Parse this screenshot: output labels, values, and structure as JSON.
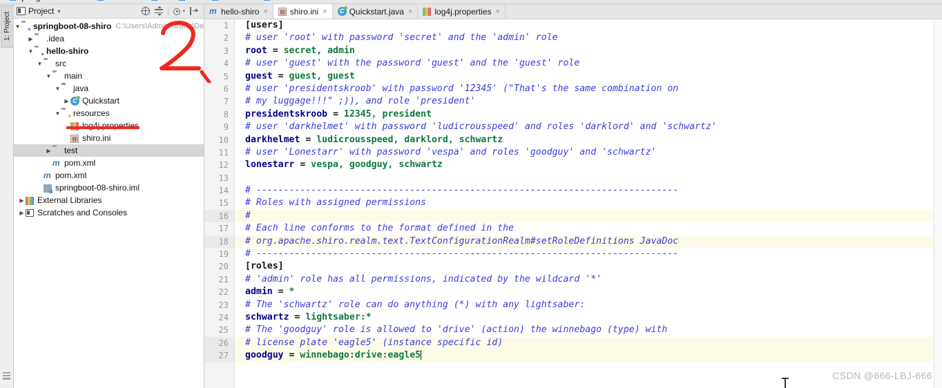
{
  "window": {
    "breadcrumbs": [
      "springboot-08-shiro",
      "hello-shiro",
      "src",
      "main",
      "resources",
      "shiro.ini"
    ]
  },
  "tool_strip": {
    "project_tab_label": "1: Project",
    "structure_icon": "structure-icon"
  },
  "project_panel": {
    "title": "Project",
    "caret": "▾",
    "actions": [
      {
        "name": "locate-icon",
        "label": "Select Opened File"
      },
      {
        "name": "collapse-all-icon",
        "label": "Collapse All"
      },
      {
        "name": "settings-gear-icon",
        "label": "Settings"
      },
      {
        "name": "hide-panel-icon",
        "label": "Hide"
      }
    ],
    "tree": [
      {
        "label": "springboot-08-shiro",
        "path": "C:\\Users\\Administrator\\Desktop\\S",
        "indent": 0,
        "arrow": "v",
        "icon": "module-folder-icon",
        "bold": true,
        "selected": false
      },
      {
        "label": ".idea",
        "path": "",
        "indent": 1,
        "arrow": ">",
        "icon": "folder-icon",
        "bold": false,
        "selected": false
      },
      {
        "label": "hello-shiro",
        "path": "",
        "indent": 1,
        "arrow": "v",
        "icon": "module-folder-icon",
        "bold": true,
        "selected": false
      },
      {
        "label": "src",
        "path": "",
        "indent": 2,
        "arrow": "v",
        "icon": "folder-icon",
        "bold": false,
        "selected": false
      },
      {
        "label": "main",
        "path": "",
        "indent": 3,
        "arrow": "v",
        "icon": "folder-icon",
        "bold": false,
        "selected": false
      },
      {
        "label": "java",
        "path": "",
        "indent": 4,
        "arrow": "v",
        "icon": "source-folder-icon",
        "bold": false,
        "selected": false
      },
      {
        "label": "Quickstart",
        "path": "",
        "indent": 5,
        "arrow": ">",
        "icon": "java-class-icon",
        "bold": false,
        "selected": false
      },
      {
        "label": "resources",
        "path": "",
        "indent": 4,
        "arrow": "v",
        "icon": "resources-folder-icon",
        "bold": false,
        "selected": false
      },
      {
        "label": "log4j.properties",
        "path": "",
        "indent": 5,
        "arrow": "",
        "icon": "properties-file-icon",
        "bold": false,
        "selected": false
      },
      {
        "label": "shiro.ini",
        "path": "",
        "indent": 5,
        "arrow": "",
        "icon": "ini-file-icon",
        "bold": false,
        "selected": false
      },
      {
        "label": "test",
        "path": "",
        "indent": 3,
        "arrow": ">",
        "icon": "folder-icon",
        "bold": false,
        "selected": true
      },
      {
        "label": "pom.xml",
        "path": "",
        "indent": 3,
        "arrow": "",
        "icon": "maven-file-icon",
        "bold": false,
        "selected": false
      },
      {
        "label": "pom.xml",
        "path": "",
        "indent": 2,
        "arrow": "",
        "icon": "maven-file-icon",
        "bold": false,
        "selected": false
      },
      {
        "label": "springboot-08-shiro.iml",
        "path": "",
        "indent": 2,
        "arrow": "",
        "icon": "iml-file-icon",
        "bold": false,
        "selected": false
      },
      {
        "label": "External Libraries",
        "path": "",
        "indent": 0,
        "arrow": ">",
        "icon": "libraries-icon",
        "bold": false,
        "selected": false
      },
      {
        "label": "Scratches and Consoles",
        "path": "",
        "indent": 0,
        "arrow": ">",
        "icon": "scratches-icon",
        "bold": false,
        "selected": false
      }
    ]
  },
  "editor": {
    "tabs": [
      {
        "label": "hello-shiro",
        "icon": "maven-file-icon",
        "active": false,
        "close": "×"
      },
      {
        "label": "shiro.ini",
        "icon": "ini-file-icon",
        "active": true,
        "close": "×"
      },
      {
        "label": "Quickstart.java",
        "icon": "java-class-icon",
        "active": false,
        "close": "×"
      },
      {
        "label": "log4j.properties",
        "icon": "properties-file-icon",
        "active": false,
        "close": "×"
      }
    ],
    "line_numbers": [
      1,
      2,
      3,
      4,
      5,
      6,
      7,
      8,
      9,
      10,
      11,
      12,
      13,
      14,
      15,
      16,
      17,
      18,
      19,
      20,
      21,
      22,
      23,
      24,
      25,
      26,
      27
    ],
    "lines": [
      {
        "n": 1,
        "type": "section",
        "text": "[users]",
        "hl": false
      },
      {
        "n": 2,
        "type": "comment",
        "text": "# user 'root' with password 'secret' and the 'admin' role",
        "hl": false
      },
      {
        "n": 3,
        "type": "entry",
        "key": "root",
        "value": " secret, admin",
        "hl": false
      },
      {
        "n": 4,
        "type": "comment",
        "text": "# user 'guest' with the password 'guest' and the 'guest' role",
        "hl": false
      },
      {
        "n": 5,
        "type": "entry",
        "key": "guest",
        "value": " guest, guest",
        "hl": false
      },
      {
        "n": 6,
        "type": "comment",
        "text": "# user 'presidentskroob' with password '12345' (\"That's the same combination on",
        "hl": false
      },
      {
        "n": 7,
        "type": "comment",
        "text": "# my luggage!!!\" ;)), and role 'president'",
        "hl": false
      },
      {
        "n": 8,
        "type": "entry",
        "key": "presidentskroob",
        "value": " 12345, president",
        "hl": false
      },
      {
        "n": 9,
        "type": "comment",
        "text": "# user 'darkhelmet' with password 'ludicrousspeed' and roles 'darklord' and 'schwartz'",
        "hl": false
      },
      {
        "n": 10,
        "type": "entry",
        "key": "darkhelmet",
        "value": " ludicrousspeed, darklord, schwartz",
        "hl": false
      },
      {
        "n": 11,
        "type": "comment",
        "text": "# user 'Lonestarr' with password 'vespa' and roles 'goodguy' and 'schwartz'",
        "hl": false
      },
      {
        "n": 12,
        "type": "entry",
        "key": "lonestarr",
        "value": " vespa, goodguy, schwartz",
        "hl": false
      },
      {
        "n": 13,
        "type": "blank",
        "text": "",
        "hl": false
      },
      {
        "n": 14,
        "type": "comment",
        "text": "# -----------------------------------------------------------------------------",
        "hl": false
      },
      {
        "n": 15,
        "type": "comment",
        "text": "# Roles with assigned permissions",
        "hl": false
      },
      {
        "n": 16,
        "type": "comment",
        "text": "#",
        "hl": true
      },
      {
        "n": 17,
        "type": "comment",
        "text": "# Each line conforms to the format defined in the",
        "hl": false
      },
      {
        "n": 18,
        "type": "comment",
        "text": "# org.apache.shiro.realm.text.TextConfigurationRealm#setRoleDefinitions JavaDoc",
        "hl": true
      },
      {
        "n": 19,
        "type": "comment",
        "text": "# -----------------------------------------------------------------------------",
        "hl": false
      },
      {
        "n": 20,
        "type": "section",
        "text": "[roles]",
        "hl": false
      },
      {
        "n": 21,
        "type": "comment",
        "text": "# 'admin' role has all permissions, indicated by the wildcard '*'",
        "hl": false
      },
      {
        "n": 22,
        "type": "entry",
        "key": "admin",
        "value": " *",
        "hl": false
      },
      {
        "n": 23,
        "type": "comment",
        "text": "# The 'schwartz' role can do anything (*) with any lightsaber:",
        "hl": false
      },
      {
        "n": 24,
        "type": "entry",
        "key": "schwartz",
        "value": " lightsaber:*",
        "hl": false
      },
      {
        "n": 25,
        "type": "comment",
        "text": "# The 'goodguy' role is allowed to 'drive' (action) the winnebago (type) with",
        "hl": false
      },
      {
        "n": 26,
        "type": "comment",
        "text": "# license plate 'eagle5' (instance specific id)",
        "hl": true
      },
      {
        "n": 27,
        "type": "entry",
        "key": "goodguy",
        "value": " winnebago:drive:eagle5",
        "hl": true,
        "caret": true
      }
    ]
  },
  "annotations": {
    "number_mark": "2",
    "underline_target": "shiro.ini"
  },
  "watermark": "CSDN @666-LBJ-666",
  "colors": {
    "comment": "#3b3bdb",
    "key": "#00008b",
    "value": "#0b7a3b",
    "annotation_red": "#ee2a1e",
    "selection_gray": "#d6d6d6",
    "highlight_yellow": "#fdfbe8"
  }
}
